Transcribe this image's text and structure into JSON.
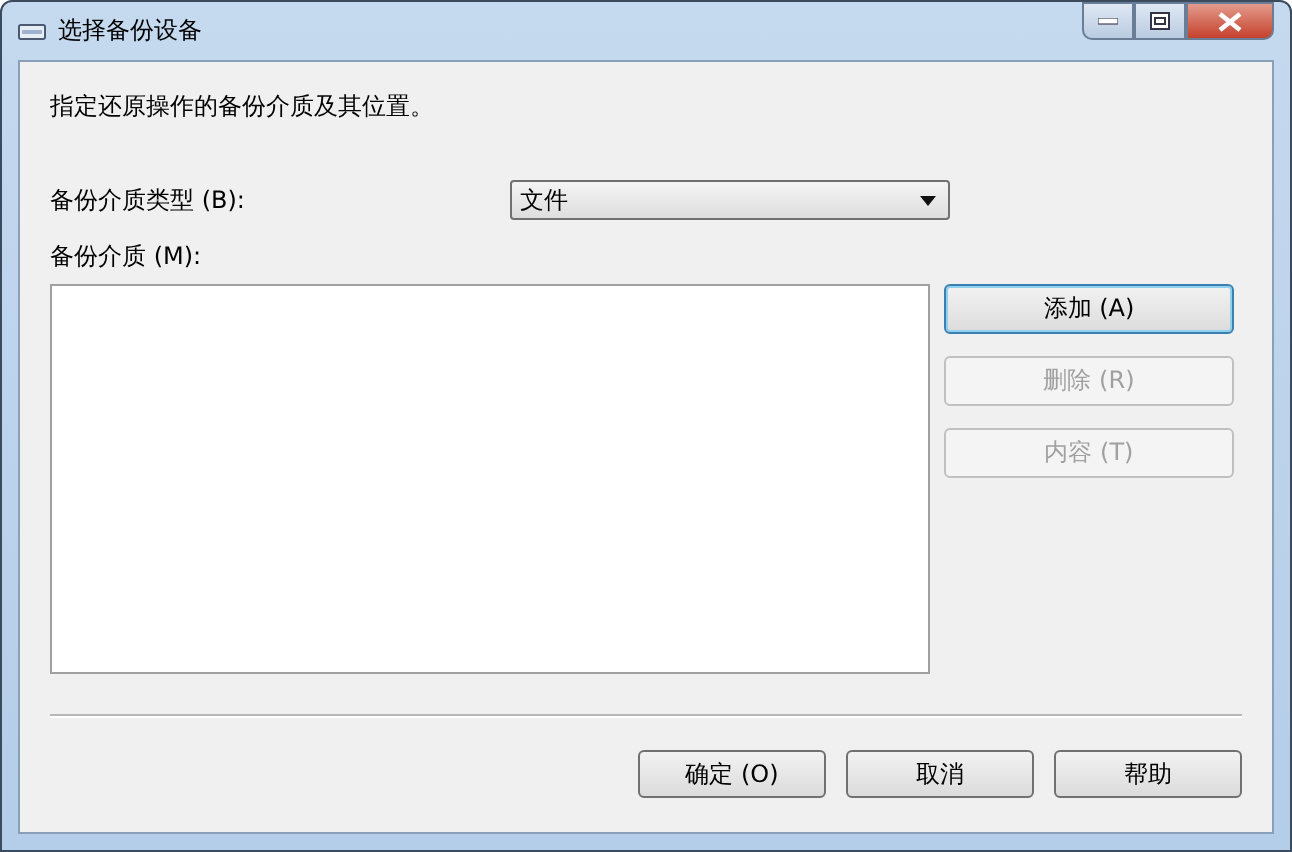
{
  "window": {
    "title": "选择备份设备"
  },
  "instruction": "指定还原操作的备份介质及其位置。",
  "media_type": {
    "label": "备份介质类型 (B):",
    "value": "文件"
  },
  "media": {
    "label": "备份介质 (M):"
  },
  "side_buttons": [
    {
      "label": "添加 (A)",
      "disabled": false,
      "focused": true
    },
    {
      "label": "删除 (R)",
      "disabled": true,
      "focused": false
    },
    {
      "label": "内容 (T)",
      "disabled": true,
      "focused": false
    }
  ],
  "buttons": [
    {
      "label": "确定 (O)",
      "disabled": false
    },
    {
      "label": "取消",
      "disabled": false
    },
    {
      "label": "帮助",
      "disabled": false
    }
  ]
}
